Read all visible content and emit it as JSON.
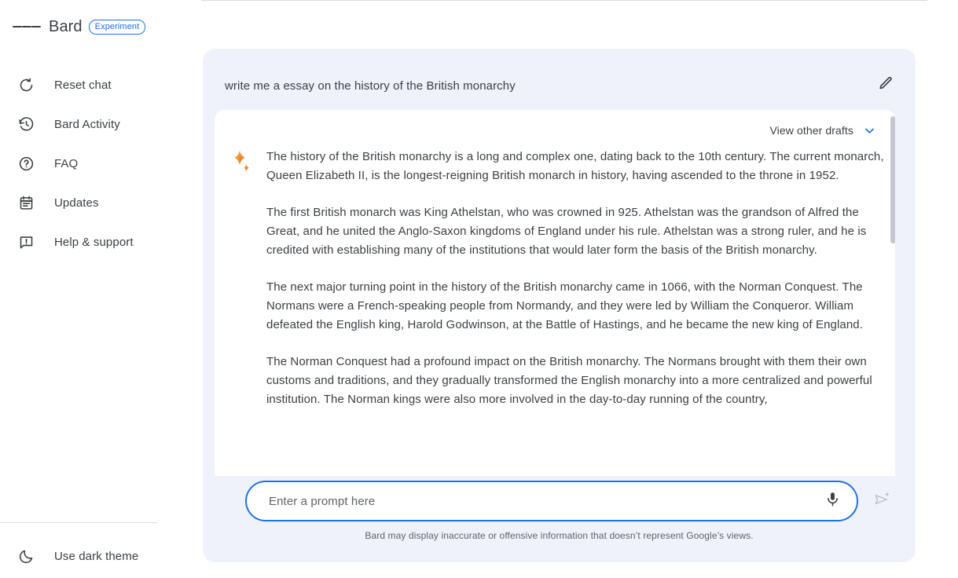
{
  "header": {
    "menu_icon": "hamburger-menu-icon",
    "brand": "Bard",
    "badge": "Experiment"
  },
  "sidebar": {
    "items": [
      {
        "label": "Reset chat",
        "icon": "reset-icon"
      },
      {
        "label": "Bard Activity",
        "icon": "history-icon"
      },
      {
        "label": "FAQ",
        "icon": "question-circle-icon"
      },
      {
        "label": "Updates",
        "icon": "calendar-icon"
      },
      {
        "label": "Help & support",
        "icon": "feedback-icon"
      }
    ],
    "theme_toggle": {
      "label": "Use dark theme",
      "icon": "moon-icon"
    }
  },
  "conversation": {
    "prompt": "write me a essay on the history of the British monarchy",
    "edit_icon": "pencil-icon",
    "drafts_label": "View other drafts",
    "drafts_icon": "chevron-down-icon",
    "bard_icon": "bard-sparkle-icon",
    "paragraphs": [
      "The history of the British monarchy is a long and complex one, dating back to the 10th century. The current monarch, Queen Elizabeth II, is the longest-reigning British monarch in history, having ascended to the throne in 1952.",
      "The first British monarch was King Athelstan, who was crowned in 925. Athelstan was the grandson of Alfred the Great, and he united the Anglo-Saxon kingdoms of England under his rule. Athelstan was a strong ruler, and he is credited with establishing many of the institutions that would later form the basis of the British monarchy.",
      "The next major turning point in the history of the British monarchy came in 1066, with the Norman Conquest. The Normans were a French-speaking people from Normandy, and they were led by William the Conqueror. William defeated the English king, Harold Godwinson, at the Battle of Hastings, and he became the new king of England.",
      "The Norman Conquest had a profound impact on the British monarchy. The Normans brought with them their own customs and traditions, and they gradually transformed the English monarchy into a more centralized and powerful institution. The Norman kings were also more involved in the day-to-day running of the country,"
    ]
  },
  "composer": {
    "placeholder": "Enter a prompt here",
    "value": "",
    "mic_icon": "microphone-icon",
    "send_icon": "send-sparkle-icon"
  },
  "footer": {
    "disclaimer": "Bard may display inaccurate or offensive information that doesn’t represent Google’s views."
  },
  "colors": {
    "accent_blue": "#1a73e8",
    "panel_bg": "#eff2fb",
    "text": "#3c4043",
    "muted": "#5f6368",
    "spark_orange": "#f2a93b",
    "spark_red": "#e8453c"
  }
}
